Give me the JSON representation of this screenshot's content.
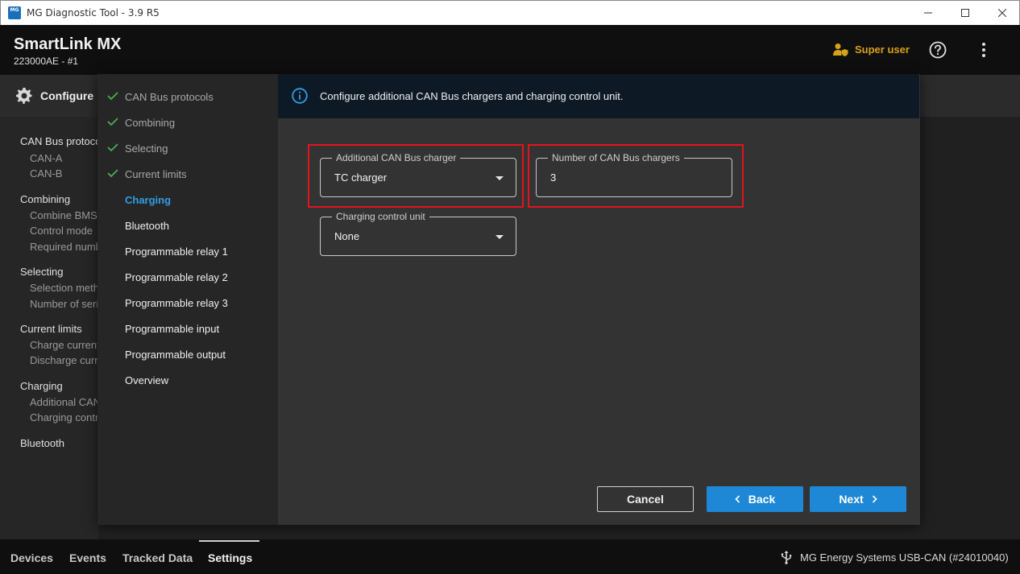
{
  "window": {
    "title": "MG Diagnostic Tool - 3.9 R5",
    "app_icon_text": "MG"
  },
  "header": {
    "device_name": "SmartLink MX",
    "device_id": "223000AE - #1",
    "user_label": "Super user"
  },
  "configure": {
    "label": "Configure"
  },
  "background_list": {
    "groups": [
      {
        "label": "CAN Bus protocols",
        "items": [
          "CAN-A",
          "CAN-B"
        ]
      },
      {
        "label": "Combining",
        "items": [
          "Combine BMS's",
          "Control mode",
          "Required number"
        ]
      },
      {
        "label": "Selecting",
        "items": [
          "Selection method",
          "Number of series"
        ]
      },
      {
        "label": "Current limits",
        "items": [
          "Charge current",
          "Discharge current"
        ]
      },
      {
        "label": "Charging",
        "items": [
          "Additional CAN",
          "Charging control"
        ]
      },
      {
        "label": "Bluetooth",
        "items": []
      }
    ]
  },
  "steps": [
    {
      "label": "CAN Bus protocols",
      "state": "done"
    },
    {
      "label": "Combining",
      "state": "done"
    },
    {
      "label": "Selecting",
      "state": "done"
    },
    {
      "label": "Current limits",
      "state": "done"
    },
    {
      "label": "Charging",
      "state": "active"
    },
    {
      "label": "Bluetooth",
      "state": "todo"
    },
    {
      "label": "Programmable relay 1",
      "state": "todo"
    },
    {
      "label": "Programmable relay 2",
      "state": "todo"
    },
    {
      "label": "Programmable relay 3",
      "state": "todo"
    },
    {
      "label": "Programmable input",
      "state": "todo"
    },
    {
      "label": "Programmable output",
      "state": "todo"
    },
    {
      "label": "Overview",
      "state": "todo"
    }
  ],
  "info": {
    "message": "Configure additional CAN Bus chargers and charging control unit."
  },
  "form": {
    "charger": {
      "label": "Additional CAN Bus charger",
      "value": "TC charger"
    },
    "charger_count": {
      "label": "Number of CAN Bus chargers",
      "value": "3"
    },
    "control_unit": {
      "label": "Charging control unit",
      "value": "None"
    }
  },
  "buttons": {
    "cancel": "Cancel",
    "back": "Back",
    "next": "Next"
  },
  "bottom_tabs": [
    "Devices",
    "Events",
    "Tracked Data",
    "Settings"
  ],
  "selected_tab": "Settings",
  "connection": "MG Energy Systems USB-CAN (#24010040)",
  "colors": {
    "accent": "#1f88d6",
    "highlight": "#e3141c",
    "check": "#4caf50",
    "user": "#d7a21a"
  }
}
